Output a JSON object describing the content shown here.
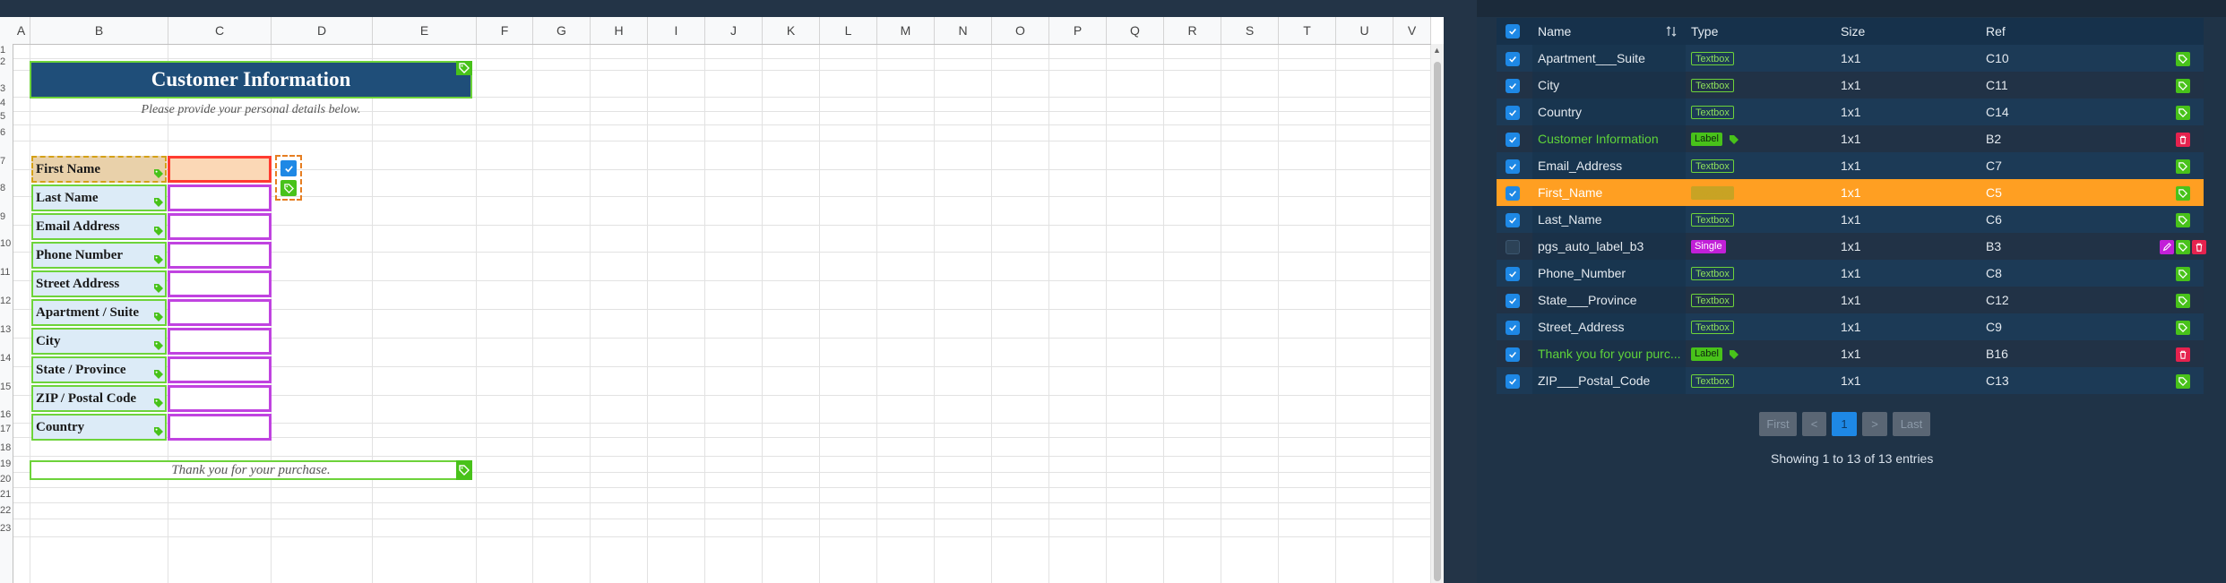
{
  "sheet": {
    "columns": [
      "A",
      "B",
      "C",
      "D",
      "E",
      "F",
      "G",
      "H",
      "I",
      "J",
      "K",
      "L",
      "M",
      "N",
      "O",
      "P",
      "Q",
      "R",
      "S",
      "T",
      "U",
      "V"
    ],
    "rows": [
      "1",
      "2",
      "3",
      "4",
      "5",
      "6",
      "7",
      "8",
      "9",
      "10",
      "11",
      "12",
      "13",
      "14",
      "15",
      "16",
      "17",
      "18",
      "19",
      "20",
      "21",
      "22",
      "23"
    ],
    "title": "Customer Information",
    "subtitle": "Please provide your personal details below.",
    "fields": [
      {
        "label": "First Name"
      },
      {
        "label": "Last Name"
      },
      {
        "label": "Email Address"
      },
      {
        "label": "Phone Number"
      },
      {
        "label": "Street Address"
      },
      {
        "label": "Apartment / Suite"
      },
      {
        "label": "City"
      },
      {
        "label": "State / Province"
      },
      {
        "label": "ZIP / Postal Code"
      },
      {
        "label": "Country"
      }
    ],
    "footer": "Thank you for your purchase."
  },
  "panel": {
    "headers": {
      "name": "Name",
      "type": "Type",
      "size": "Size",
      "ref": "Ref",
      "sort_icon": "sort-icon"
    },
    "rows": [
      {
        "checked": true,
        "name": "Apartment___Suite",
        "type": "Textbox",
        "size": "1x1",
        "ref": "C10"
      },
      {
        "checked": true,
        "name": "City",
        "type": "Textbox",
        "size": "1x1",
        "ref": "C11"
      },
      {
        "checked": true,
        "name": "Country",
        "type": "Textbox",
        "size": "1x1",
        "ref": "C14"
      },
      {
        "checked": true,
        "name": "Customer Information",
        "type": "Label",
        "size": "1x1",
        "ref": "B2"
      },
      {
        "checked": true,
        "name": "Email_Address",
        "type": "Textbox",
        "size": "1x1",
        "ref": "C7"
      },
      {
        "checked": true,
        "name": "First_Name",
        "type": "Textbox",
        "size": "1x1",
        "ref": "C5"
      },
      {
        "checked": true,
        "name": "Last_Name",
        "type": "Textbox",
        "size": "1x1",
        "ref": "C6"
      },
      {
        "checked": false,
        "name": "pgs_auto_label_b3",
        "type": "Single",
        "size": "1x1",
        "ref": "B3"
      },
      {
        "checked": true,
        "name": "Phone_Number",
        "type": "Textbox",
        "size": "1x1",
        "ref": "C8"
      },
      {
        "checked": true,
        "name": "State___Province",
        "type": "Textbox",
        "size": "1x1",
        "ref": "C12"
      },
      {
        "checked": true,
        "name": "Street_Address",
        "type": "Textbox",
        "size": "1x1",
        "ref": "C9"
      },
      {
        "checked": true,
        "name": "Thank you for your purc...",
        "type": "Label",
        "size": "1x1",
        "ref": "B16"
      },
      {
        "checked": true,
        "name": "ZIP___Postal_Code",
        "type": "Textbox",
        "size": "1x1",
        "ref": "C13"
      }
    ],
    "pagination": {
      "first": "First",
      "prev": "<",
      "page": "1",
      "next": ">",
      "last": "Last"
    },
    "entries_text": "Showing 1 to 13 of 13 entries"
  },
  "colors": {
    "title_bg": "#1f4e79",
    "label_bg": "#dcebf7",
    "tag_green": "#48c21a",
    "input_border": "#c043e0",
    "selected_row": "#ff9f22"
  }
}
